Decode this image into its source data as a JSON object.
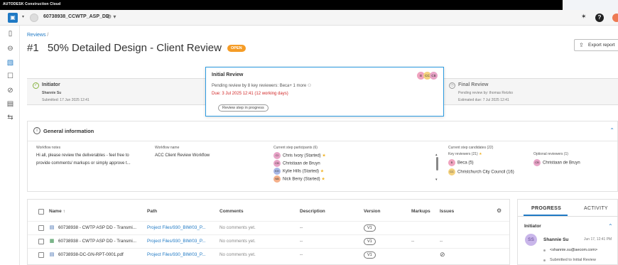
{
  "topbar": {
    "brand": "AUTODESK Construction Cloud"
  },
  "project": {
    "name": "60738938_CCWTP_ASP_DD"
  },
  "breadcrumb": {
    "root": "Reviews",
    "sep": "/"
  },
  "review": {
    "number": "#1",
    "title": "50% Detailed Design - Client Review",
    "status": "OPEN",
    "export_label": "Export report"
  },
  "steps": {
    "initiator": {
      "title": "Initiator",
      "person": "Shannie Su",
      "submitted": "Submitted: 17 Jun 2025 12:41"
    },
    "current": {
      "title": "Initial Review",
      "desc": "Pending review by 8 key reviewers: Beca+ 1 more",
      "due": "Due:  3 Jul 2025 12:41 (12 working days)",
      "status_btn": "Review step in progress",
      "avatars": [
        "B",
        "CC",
        "CB"
      ]
    },
    "final": {
      "title": "Final Review",
      "pending": "Pending review by: thomas Retzko",
      "estimated": "Estimated due: 7 Jul 2025 12:41"
    }
  },
  "general": {
    "title": "General information",
    "notes_label": "Workflow notes",
    "notes_line1": "Hi all, please review the deliverables - feel free to",
    "notes_line2": "provide comments/ markups or simply approve t...",
    "workflow_label": "Workflow name",
    "workflow_value": "ACC Client Review Workflow",
    "participants_label": "Current step participants (6)",
    "participants": [
      {
        "initials": "CI",
        "name": "Chris Ivory (Started)",
        "color": "#e8a3c7"
      },
      {
        "initials": "CB",
        "name": "Christiaan de Bruyn",
        "color": "#e8a3c7"
      },
      {
        "initials": "KH",
        "name": "Kylie Hills (Started)",
        "color": "#a9b8e6"
      },
      {
        "initials": "NB",
        "name": "Nick Berry (Started)",
        "color": "#f5b08a"
      }
    ],
    "candidates_label": "Current step candidates (22)",
    "key_reviewers_label": "Key reviewers (21)",
    "key_reviewers": [
      {
        "initials": "B",
        "name": "Beca (5)",
        "color": "#f0a3bf"
      },
      {
        "initials": "CC",
        "name": "Christchurch City Council (16)",
        "color": "#f4d27e"
      }
    ],
    "optional_label": "Optional reviewers (1)",
    "optional_reviewers": [
      {
        "initials": "CB",
        "name": "Christiaan de Bruyn",
        "color": "#e8a3c7"
      }
    ]
  },
  "files": {
    "headers": {
      "name": "Name",
      "path": "Path",
      "comments": "Comments",
      "description": "Description",
      "version": "Version",
      "markups": "Markups",
      "issues": "Issues"
    },
    "rows": [
      {
        "name": "60738938 - CWTP ASP DD - Transmi...",
        "path": "Project Files/930_BIM/03_P...",
        "comments": "No comments yet.",
        "description": "--",
        "version": "V1",
        "markups": "",
        "issues": ""
      },
      {
        "name": "60738938 - CWTP ASP DD - Transmi...",
        "path": "Project Files/930_BIM/03_P...",
        "comments": "No comments yet.",
        "description": "--",
        "version": "V1",
        "markups": "--",
        "issues": "--"
      },
      {
        "name": "60738938-DC-GN-RPT-0001.pdf",
        "path": "Project Files/930_BIM/03_P...",
        "comments": "No comments yet.",
        "description": "--",
        "version": "V1",
        "markups": "",
        "issues": ""
      }
    ]
  },
  "progress": {
    "tab_progress": "PROGRESS",
    "tab_activity": "ACTIVITY",
    "section": "Initiator",
    "avatar": "SS",
    "name": "Shannie Su",
    "time": "Jun 17, 12:41 PM",
    "email": "<shannie.su@aecom.com>",
    "event": "Submitted to Initial Review"
  }
}
